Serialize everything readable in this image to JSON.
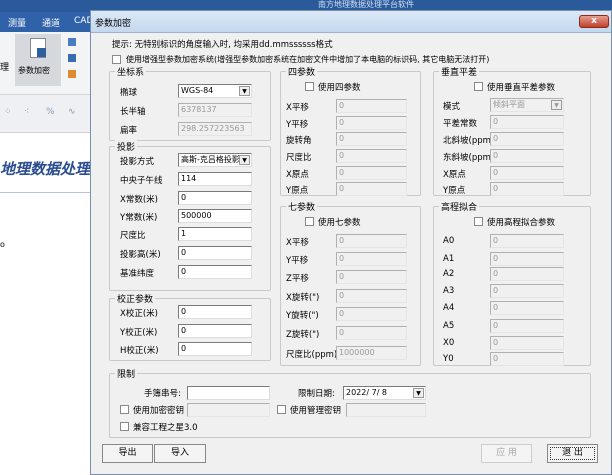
{
  "app": {
    "title": "南方地理数据处理平台软件",
    "tabs": [
      "测量",
      "通道",
      "CAD"
    ],
    "ribbon_label": "理",
    "ribbon_button": "参数加密",
    "doc_title": "地理数据处理平",
    "side_mark": "o"
  },
  "dialog": {
    "title": "参数加密",
    "close_label": "x",
    "hint": "提示: 无特别标识的角度输入时, 均采用dd.mmssssss格式",
    "enhanced_checkbox": "使用增强型参数加密系统(增强型参数加密系统在加密文件中增加了本电脑的标识码, 其它电脑无法打开)",
    "coord": {
      "title": "坐标系",
      "rows": [
        {
          "label": "椭球",
          "value": "WGS-84",
          "type": "combo"
        },
        {
          "label": "长半轴",
          "value": "6378137",
          "disabled": true
        },
        {
          "label": "扁率",
          "value": "298.257223563",
          "disabled": true
        }
      ]
    },
    "proj": {
      "title": "投影",
      "rows": [
        {
          "label": "投影方式",
          "value": "高斯-克吕格投影",
          "type": "combo"
        },
        {
          "label": "中央子午线",
          "value": "114"
        },
        {
          "label": "X常数(米)",
          "value": "0"
        },
        {
          "label": "Y常数(米)",
          "value": "500000"
        },
        {
          "label": "尺度比",
          "value": "1"
        },
        {
          "label": "投影高(米)",
          "value": "0"
        },
        {
          "label": "基准纬度",
          "value": "0"
        }
      ]
    },
    "corr": {
      "title": "校正参数",
      "rows": [
        {
          "label": "X校正(米)",
          "value": "0"
        },
        {
          "label": "Y校正(米)",
          "value": "0"
        },
        {
          "label": "H校正(米)",
          "value": "0"
        }
      ]
    },
    "four": {
      "title": "四参数",
      "checkbox": "使用四参数",
      "rows": [
        {
          "label": "X平移",
          "value": "0",
          "disabled": true
        },
        {
          "label": "Y平移",
          "value": "0",
          "disabled": true
        },
        {
          "label": "旋转角",
          "value": "0",
          "disabled": true
        },
        {
          "label": "尺度比",
          "value": "0",
          "disabled": true
        },
        {
          "label": "X原点",
          "value": "0",
          "disabled": true
        },
        {
          "label": "Y原点",
          "value": "0",
          "disabled": true
        }
      ]
    },
    "vert": {
      "title": "垂直平差",
      "checkbox": "使用垂直平差参数",
      "rows": [
        {
          "label": "模式",
          "value": "倾斜平面",
          "type": "combo",
          "disabled": true
        },
        {
          "label": "平差常数",
          "value": "0",
          "disabled": true
        },
        {
          "label": "北斜坡(ppm)",
          "value": "0",
          "disabled": true
        },
        {
          "label": "东斜坡(ppm)",
          "value": "0",
          "disabled": true
        },
        {
          "label": "X原点",
          "value": "0",
          "disabled": true
        },
        {
          "label": "Y原点",
          "value": "0",
          "disabled": true
        }
      ]
    },
    "seven": {
      "title": "七参数",
      "checkbox": "使用七参数",
      "rows": [
        {
          "label": "X平移",
          "value": "0",
          "disabled": true
        },
        {
          "label": "Y平移",
          "value": "0",
          "disabled": true
        },
        {
          "label": "Z平移",
          "value": "0",
          "disabled": true
        },
        {
          "label": "X旋转(\")",
          "value": "0",
          "disabled": true
        },
        {
          "label": "Y旋转(\")",
          "value": "0",
          "disabled": true
        },
        {
          "label": "Z旋转(\")",
          "value": "0",
          "disabled": true
        },
        {
          "label": "尺度比(ppm)",
          "value": "1000000",
          "disabled": true
        }
      ]
    },
    "height": {
      "title": "高程拟合",
      "checkbox": "使用高程拟合参数",
      "rows": [
        {
          "label": "A0",
          "value": "0",
          "disabled": true
        },
        {
          "label": "A1",
          "value": "0",
          "disabled": true
        },
        {
          "label": "A2",
          "value": "0",
          "disabled": true
        },
        {
          "label": "A3",
          "value": "0",
          "disabled": true
        },
        {
          "label": "A4",
          "value": "0",
          "disabled": true
        },
        {
          "label": "A5",
          "value": "0",
          "disabled": true
        },
        {
          "label": "X0",
          "value": "0",
          "disabled": true
        },
        {
          "label": "Y0",
          "value": "0",
          "disabled": true
        }
      ]
    },
    "limit": {
      "title": "限制",
      "serial_label": "手簿串号:",
      "serial_value": "",
      "date_label": "限制日期:",
      "date_value": "2022/ 7/ 8",
      "enc_key": "使用加密密钥",
      "admin_key": "使用管理密钥",
      "compat": "兼容工程之星3.0"
    },
    "buttons": {
      "export": "导出",
      "import": "导入",
      "apply": "应 用",
      "exit": "退 出"
    }
  }
}
